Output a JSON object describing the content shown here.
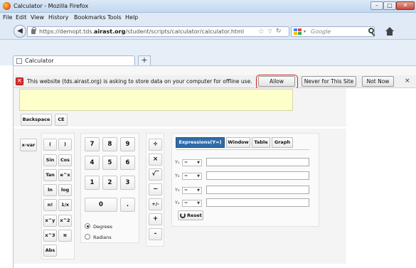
{
  "window": {
    "title": "Calculator - Mozilla Firefox"
  },
  "menu": [
    "File",
    "Edit",
    "View",
    "History",
    "Bookmarks",
    "Tools",
    "Help"
  ],
  "nav": {
    "url_prefix": "https://demopt.tds.",
    "url_domain": "airast.org",
    "url_path": "/student/scripts/calculator/calculator.html",
    "search_placeholder": "Google"
  },
  "tab": {
    "label": "Calculator",
    "new_tab": "+"
  },
  "notification": {
    "text": "This website (tds.airast.org) is asking to store data on your computer for offline use.",
    "allow": "Allow",
    "never": "Never for This Site",
    "not_now": "Not Now",
    "close": "×"
  },
  "calculator": {
    "top_buttons": [
      "Backspace",
      "CE"
    ],
    "xvar": "x-var",
    "func_buttons": [
      "(",
      ")",
      "Sin",
      "Cos",
      "Tan",
      "e^x",
      "ln",
      "log",
      "n!",
      "1/x",
      "x^y",
      "x^2",
      "x^3",
      "π",
      "Abs"
    ],
    "num_buttons": [
      "7",
      "8",
      "9",
      "4",
      "5",
      "6",
      "1",
      "2",
      "3",
      "0",
      "."
    ],
    "op_buttons": [
      "÷",
      "×",
      "√‾",
      "−",
      "+/-",
      "+",
      "-"
    ],
    "angle_modes": [
      "Degrees",
      "Radians"
    ],
    "selected_angle_mode": "Degrees",
    "graph_tabs": [
      "Expressions(Y=)",
      "Window",
      "Table",
      "Graph"
    ],
    "active_graph_tab": "Expressions(Y=)",
    "y_rows": [
      {
        "label": "Y₁",
        "op": "="
      },
      {
        "label": "Y₂",
        "op": "="
      },
      {
        "label": "Y₃",
        "op": "="
      },
      {
        "label": "Y₄",
        "op": "="
      }
    ],
    "reset": "Reset"
  }
}
